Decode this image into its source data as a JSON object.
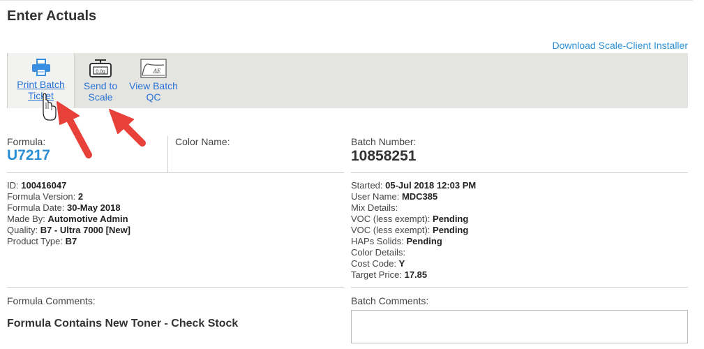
{
  "page": {
    "title": "Enter Actuals"
  },
  "links": {
    "installer": "Download Scale-Client Installer"
  },
  "toolbar": {
    "print": {
      "label_line1": "Print Batch",
      "label_line2": "Ticket",
      "icon": "printer-icon"
    },
    "scale": {
      "label_line1": "Send to",
      "label_line2": "Scale",
      "icon": "scale-icon",
      "scale_readout": "0.0g"
    },
    "qc": {
      "label_line1": "View Batch",
      "label_line2": "QC",
      "icon": "delta-e-chart-icon",
      "glyph": "ΔE"
    }
  },
  "formula": {
    "label": "Formula:",
    "value": "U7217"
  },
  "color": {
    "label": "Color Name:"
  },
  "batch": {
    "label": "Batch Number:",
    "value": "10858251"
  },
  "left_details": [
    {
      "label": "ID: ",
      "value": "100416047"
    },
    {
      "label": "Formula Version: ",
      "value": "2"
    },
    {
      "label": "Formula Date: ",
      "value": "30-May 2018"
    },
    {
      "label": "Made By: ",
      "value": "Automotive Admin"
    },
    {
      "label": "Quality: ",
      "value": "B7 - Ultra 7000 [New]"
    },
    {
      "label": "Product Type: ",
      "value": "B7"
    }
  ],
  "right_details": [
    {
      "label": "Started: ",
      "value": "05-Jul 2018 12:03 PM"
    },
    {
      "label": "User Name: ",
      "value": "MDC385"
    },
    {
      "label": "Mix Details:",
      "value": ""
    },
    {
      "label": "VOC (less exempt): ",
      "value": "Pending"
    },
    {
      "label": "VOC (less exempt): ",
      "value": "Pending"
    },
    {
      "label": "HAPs Solids: ",
      "value": "Pending"
    },
    {
      "label": "Color Details:",
      "value": ""
    },
    {
      "label": "Cost Code: ",
      "value": "Y"
    },
    {
      "label": "Target Price: ",
      "value": "17.85"
    }
  ],
  "comments": {
    "formula_label": "Formula Comments:",
    "formula_text": "Formula Contains New Toner - Check Stock",
    "batch_label": "Batch Comments:"
  },
  "colors": {
    "link": "#2a8fd6",
    "arrow": "#e8413a",
    "toolbar_bg": "#e4e4e1"
  }
}
